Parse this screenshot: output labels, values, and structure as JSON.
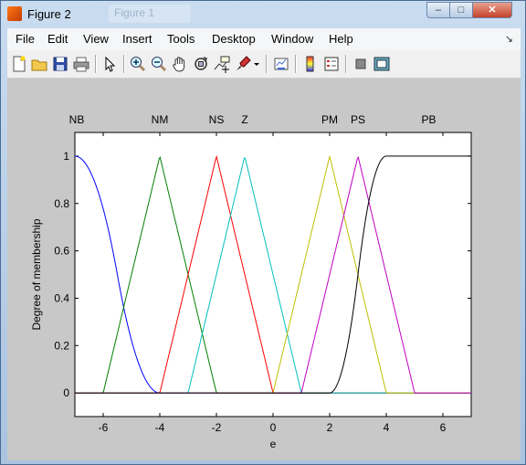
{
  "window": {
    "title": "Figure 2",
    "ghost_tab": "Figure 1"
  },
  "menu": [
    "File",
    "Edit",
    "View",
    "Insert",
    "Tools",
    "Desktop",
    "Window",
    "Help"
  ],
  "toolbar_icons": [
    "new-figure-icon",
    "open-file-icon",
    "save-icon",
    "print-icon",
    "select-arrow-icon",
    "zoom-in-icon",
    "zoom-out-icon",
    "pan-hand-icon",
    "rotate-3d-icon",
    "data-cursor-icon",
    "brush-icon",
    "link-plot-icon",
    "colorbar-icon",
    "legend-icon",
    "hide-plot-tools-icon",
    "show-plot-tools-icon"
  ],
  "chart_data": {
    "type": "line",
    "xlabel": "e",
    "ylabel": "Degree of membership",
    "xlim": [
      -7,
      7
    ],
    "ylim": [
      -0.1,
      1.1
    ],
    "xticks": [
      -6,
      -4,
      -2,
      0,
      2,
      4,
      6
    ],
    "yticks": [
      0,
      0.2,
      0.4,
      0.6,
      0.8,
      1
    ],
    "series": [
      {
        "name": "NB",
        "shape": "zmf",
        "params": [
          -7,
          -4
        ],
        "color": "#0000ff",
        "label_x": -7
      },
      {
        "name": "NM",
        "shape": "trimf",
        "params": [
          -6,
          -4,
          -2
        ],
        "color": "#008000",
        "label_x": -4
      },
      {
        "name": "NS",
        "shape": "trimf",
        "params": [
          -4,
          -2,
          0
        ],
        "color": "#ff0000",
        "label_x": -2
      },
      {
        "name": "Z",
        "shape": "trimf",
        "params": [
          -3,
          -1,
          1
        ],
        "color": "#00bfbf",
        "label_x": -1
      },
      {
        "name": "PM",
        "shape": "trimf",
        "params": [
          0,
          2,
          4
        ],
        "color": "#bfbf00",
        "label_x": 2
      },
      {
        "name": "PS",
        "shape": "trimf",
        "params": [
          1,
          3,
          5
        ],
        "color": "#bf00bf",
        "label_x": 3
      },
      {
        "name": "PB",
        "shape": "smf",
        "params": [
          2,
          4
        ],
        "color": "#000000",
        "label_x": 5.5
      }
    ]
  }
}
